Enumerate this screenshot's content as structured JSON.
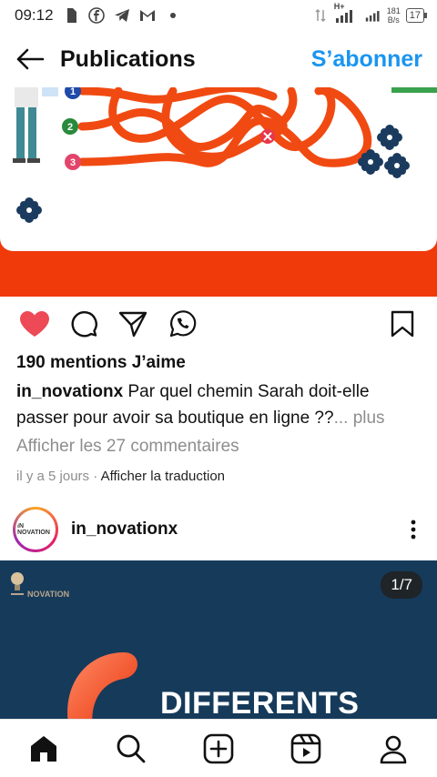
{
  "status_bar": {
    "time": "09:12",
    "net_speed_value": "181",
    "net_speed_unit": "B/s",
    "battery": "17",
    "network_type": "H+"
  },
  "header": {
    "title": "Publications",
    "subscribe_label": "S’abonner"
  },
  "post": {
    "likes": "190 mentions J’aime",
    "username": "in_novationx",
    "caption": "Par quel chemin Sarah doit-elle passer pour avoir sa boutique en ligne ??",
    "more_label": "... plus",
    "comments_link": "Afficher les 27 commentaires",
    "time_ago": "il y a 5 jours",
    "separator": "·",
    "translate_label": "Afficher la traduction",
    "maze_numbers": [
      "1",
      "2",
      "3"
    ]
  },
  "next_post": {
    "username": "in_novationx",
    "avatar_text": "IN NOVATION",
    "logo_text": "NOVATION",
    "page_indicator": "1/7",
    "headline": "DIFFERENTS"
  },
  "colors": {
    "accent_blue": "#1a95f0",
    "like_red": "#ed4956",
    "post_orange": "#f03a0a",
    "post2_bg": "#163a5a"
  },
  "icons": {
    "back": "arrow-left-icon",
    "like": "heart-filled-icon",
    "comment": "comment-bubble-icon",
    "share": "paper-plane-icon",
    "whatsapp": "whatsapp-icon",
    "save": "bookmark-icon",
    "more": "more-vertical-icon",
    "nav_home": "home-icon",
    "nav_search": "search-icon",
    "nav_create": "plus-square-icon",
    "nav_reels": "reels-icon",
    "nav_profile": "profile-icon"
  }
}
